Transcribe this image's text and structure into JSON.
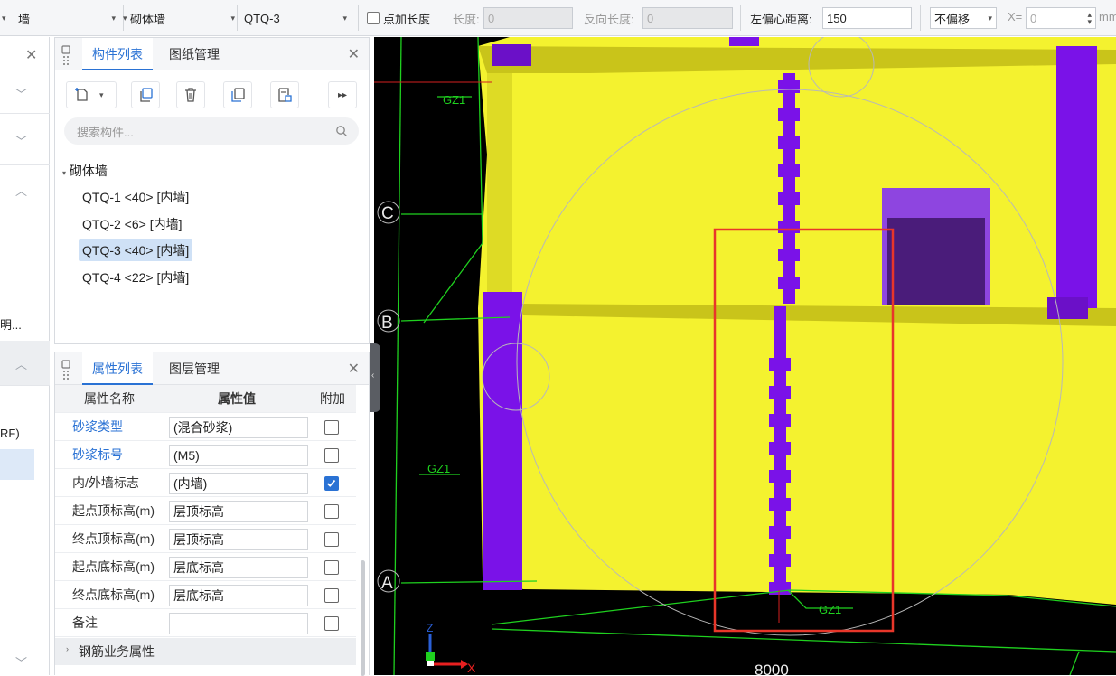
{
  "toolbar": {
    "type_select": "墙",
    "category_select": "砌体墙",
    "component_select": "QTQ-3",
    "point_length_label": "点加长度",
    "length_label": "长度:",
    "length_value": "0",
    "reverse_length_label": "反向长度:",
    "reverse_length_value": "0",
    "left_offset_label": "左偏心距离:",
    "left_offset_value": "150",
    "offset_mode_select": "不偏移",
    "x_label": "X=",
    "x_value": "0",
    "unit": "mm"
  },
  "left_panel": {
    "truncated_text_1": "明...",
    "truncated_text_2": "RF)"
  },
  "component_panel": {
    "tabs": [
      "构件列表",
      "图纸管理"
    ],
    "search_placeholder": "搜索构件...",
    "tree_root": "砌体墙",
    "items": [
      {
        "label": "QTQ-1 <40> [内墙]",
        "selected": false
      },
      {
        "label": "QTQ-2 <6> [内墙]",
        "selected": false
      },
      {
        "label": "QTQ-3 <40> [内墙]",
        "selected": true
      },
      {
        "label": "QTQ-4 <22> [内墙]",
        "selected": false
      }
    ]
  },
  "property_panel": {
    "tabs": [
      "属性列表",
      "图层管理"
    ],
    "headers": {
      "name": "属性名称",
      "value": "属性值",
      "extra": "附加"
    },
    "rows": [
      {
        "name": "砂浆类型",
        "value": "(混合砂浆)",
        "checked": false,
        "highlight": true
      },
      {
        "name": "砂浆标号",
        "value": "(M5)",
        "checked": false,
        "highlight": true
      },
      {
        "name": "内/外墙标志",
        "value": "(内墙)",
        "checked": true,
        "highlight": false
      },
      {
        "name": "起点顶标高(m)",
        "value": "层顶标高",
        "checked": false,
        "highlight": false
      },
      {
        "name": "终点顶标高(m)",
        "value": "层顶标高",
        "checked": false,
        "highlight": false
      },
      {
        "name": "起点底标高(m)",
        "value": "层底标高",
        "checked": false,
        "highlight": false
      },
      {
        "name": "终点底标高(m)",
        "value": "层底标高",
        "checked": false,
        "highlight": false
      },
      {
        "name": "备注",
        "value": "",
        "checked": false,
        "highlight": false
      }
    ],
    "group": "钢筋业务属性"
  },
  "viewport": {
    "axis_labels": [
      "C",
      "B",
      "A"
    ],
    "column_labels": [
      "GZ1",
      "GZ1",
      "GZ1"
    ],
    "dimension": "8000",
    "gizmo_z": "Z",
    "gizmo_x": "X"
  },
  "colors": {
    "accent": "#2a72d4",
    "wall_yellow": "#f4f22f",
    "column_purple": "#7a12e8",
    "grid_green": "#1fd11f",
    "selection_red": "#e8362a"
  }
}
